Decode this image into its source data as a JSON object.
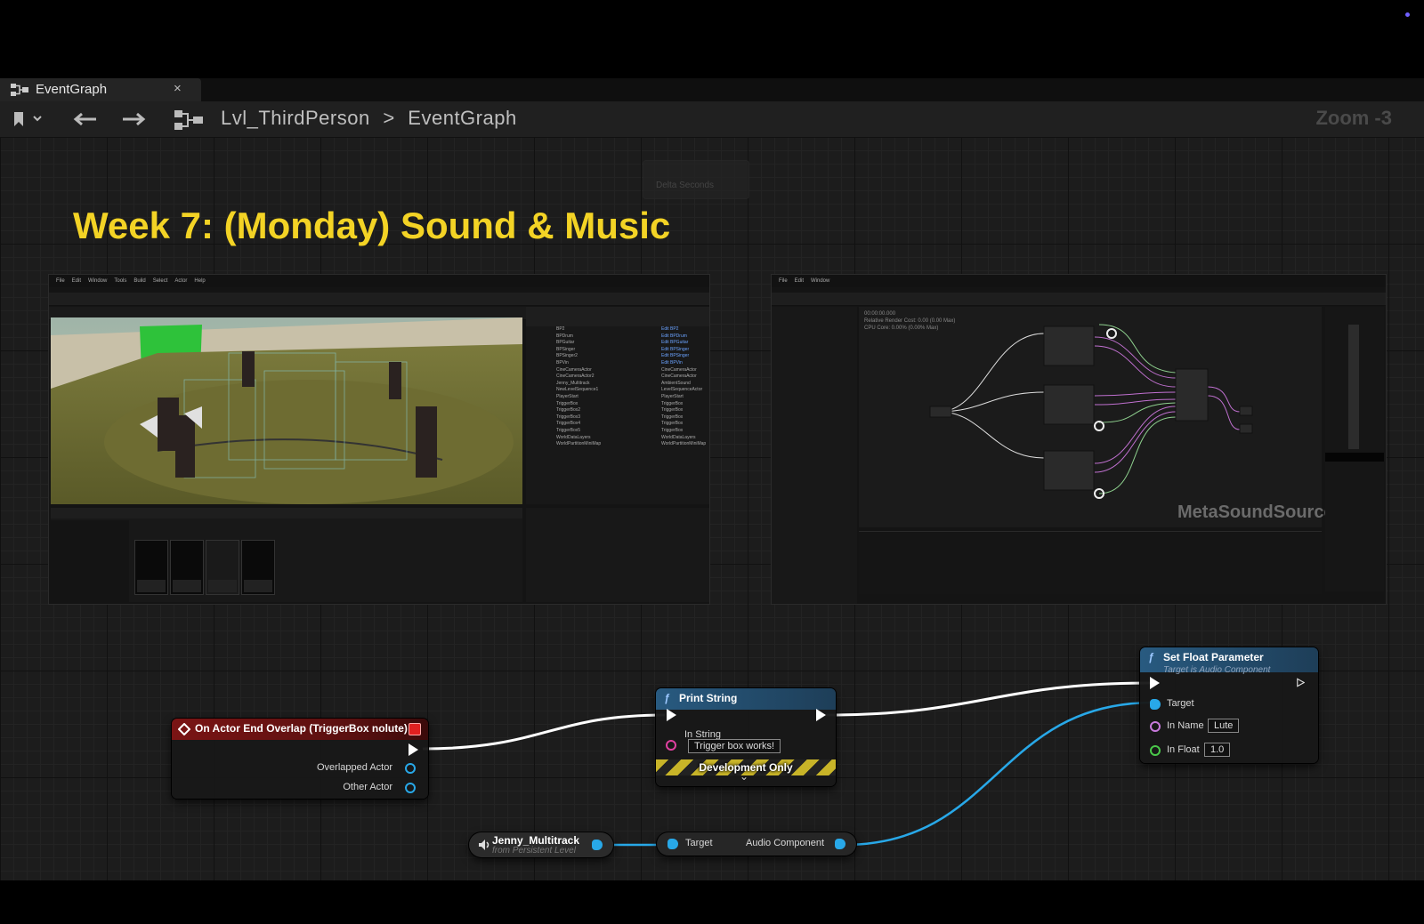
{
  "tab": {
    "label": "EventGraph",
    "close": "×"
  },
  "breadcrumb": {
    "level": "Lvl_ThirdPerson",
    "separator": ">",
    "graph": "EventGraph"
  },
  "zoom": "Zoom -3",
  "ghost_node": {
    "pin": "Delta Seconds"
  },
  "slide_title": "Week 7: (Monday) Sound & Music",
  "embedded": {
    "metasound_label": "MetaSoundSource",
    "ms_stats": [
      "00:00:00.000",
      "Relative Render Cost: 0.00 (0.00 Max)",
      "CPU Core: 0.00% (0.00% Max)"
    ],
    "menu": [
      "File",
      "Edit",
      "Window",
      "Tools",
      "Build",
      "Select",
      "Actor",
      "Help"
    ],
    "outliner_rows": [
      {
        "name": "BP2",
        "type": "Edit BP2"
      },
      {
        "name": "BPDrum",
        "type": "Edit BPDrum"
      },
      {
        "name": "BPGuitar",
        "type": "Edit BPGuitar"
      },
      {
        "name": "BPSinger",
        "type": "Edit BPSinger"
      },
      {
        "name": "BPSinger2",
        "type": "Edit BPSinger"
      },
      {
        "name": "BPVin",
        "type": "Edit BPVin"
      },
      {
        "name": "CineCameraActor",
        "type": "CineCameraActor"
      },
      {
        "name": "CineCameraActor2",
        "type": "CineCameraActor"
      },
      {
        "name": "Jenny_Multitrack",
        "type": "AmbientSound"
      },
      {
        "name": "NewLevelSequence1",
        "type": "LevelSequenceActor"
      },
      {
        "name": "PlayerStart",
        "type": "PlayerStart"
      },
      {
        "name": "TriggerBox",
        "type": "TriggerBox"
      },
      {
        "name": "TriggerBox2",
        "type": "TriggerBox"
      },
      {
        "name": "TriggerBox3",
        "type": "TriggerBox"
      },
      {
        "name": "TriggerBox4",
        "type": "TriggerBox"
      },
      {
        "name": "TriggerBox5",
        "type": "TriggerBox"
      },
      {
        "name": "WorldDataLayers",
        "type": "WorldDataLayers"
      },
      {
        "name": "WorldPartitionMiniMap",
        "type": "WorldPartitionMiniMap"
      }
    ]
  },
  "nodes": {
    "overlap": {
      "title": "On Actor End Overlap (TriggerBox nolute)",
      "pins": [
        "Overlapped Actor",
        "Other Actor"
      ]
    },
    "print": {
      "title": "Print String",
      "in_string_label": "In String",
      "in_string_value": "Trigger box works!",
      "dev_only": "Development Only",
      "expand": "⌄"
    },
    "setfloat": {
      "title": "Set Float Parameter",
      "subtitle": "Target is Audio Component",
      "target": "Target",
      "in_name_label": "In Name",
      "in_name_value": "Lute",
      "in_float_label": "In Float",
      "in_float_value": "1.0"
    },
    "jenny": {
      "title": "Jenny_Multitrack",
      "subtitle": "from Persistent Level"
    },
    "getter": {
      "target": "Target",
      "output": "Audio Component"
    }
  },
  "colors": {
    "title_yellow": "#f3d325",
    "event_red": "#7a1414",
    "function_blue": "#285a80",
    "object_pin": "#28a8e8",
    "name_pin": "#c87adc",
    "float_pin": "#4ac84a",
    "string_pin": "#e040a0"
  }
}
